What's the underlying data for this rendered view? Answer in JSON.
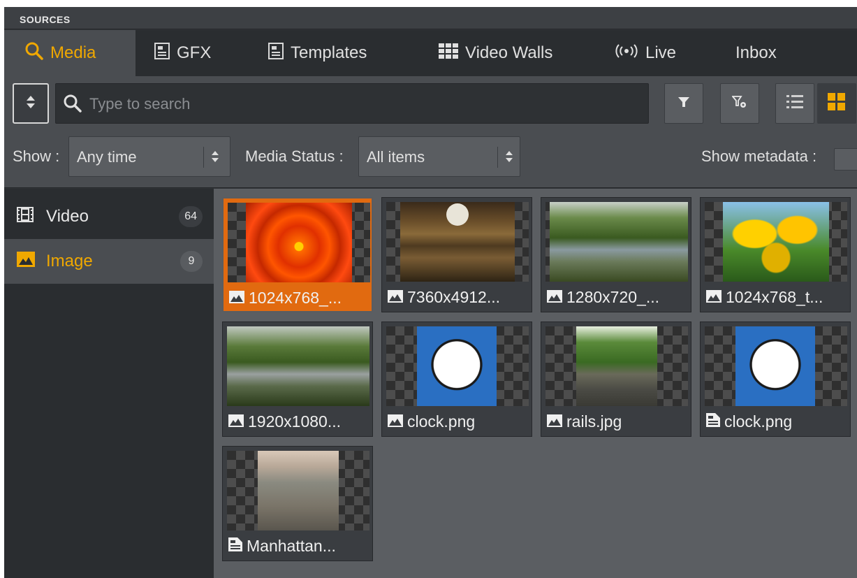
{
  "panel": {
    "title": "SOURCES"
  },
  "tabs": [
    {
      "label": "Media",
      "icon": "search-icon",
      "active": true
    },
    {
      "label": "GFX",
      "icon": "template-icon"
    },
    {
      "label": "Templates",
      "icon": "template-icon"
    },
    {
      "label": "Video Walls",
      "icon": "grid-icon"
    },
    {
      "label": "Live",
      "icon": "broadcast-icon"
    },
    {
      "label": "Inbox",
      "icon": ""
    }
  ],
  "toolbar": {
    "search_placeholder": "Type to search",
    "buttons": [
      "sort-arrows-icon",
      "filter-icon",
      "filter-settings-icon",
      "list-view-icon",
      "grid-view-icon"
    ]
  },
  "filters": {
    "show_label": "Show :",
    "show_value": "Any time",
    "status_label": "Media Status :",
    "status_value": "All items",
    "metadata_label": "Show metadata :"
  },
  "sidebar": {
    "items": [
      {
        "label": "Video",
        "count": "64",
        "icon": "film-icon"
      },
      {
        "label": "Image",
        "count": "9",
        "icon": "image-icon",
        "selected": true
      }
    ]
  },
  "grid": {
    "items": [
      {
        "label": "1024x768_...",
        "icon": "image-icon",
        "selected": true
      },
      {
        "label": "7360x4912...",
        "icon": "image-icon"
      },
      {
        "label": "1280x720_...",
        "icon": "image-icon"
      },
      {
        "label": "1024x768_t...",
        "icon": "image-icon"
      },
      {
        "label": "1920x1080...",
        "icon": "image-icon"
      },
      {
        "label": "clock.png",
        "icon": "image-icon"
      },
      {
        "label": "rails.jpg",
        "icon": "image-icon"
      },
      {
        "label": "clock.png",
        "icon": "document-icon"
      },
      {
        "label": "Manhattan...",
        "icon": "document-icon"
      }
    ]
  },
  "colors": {
    "accent": "#f0a800",
    "selected_card": "#e16a10",
    "panel_bg": "#2f3236"
  }
}
